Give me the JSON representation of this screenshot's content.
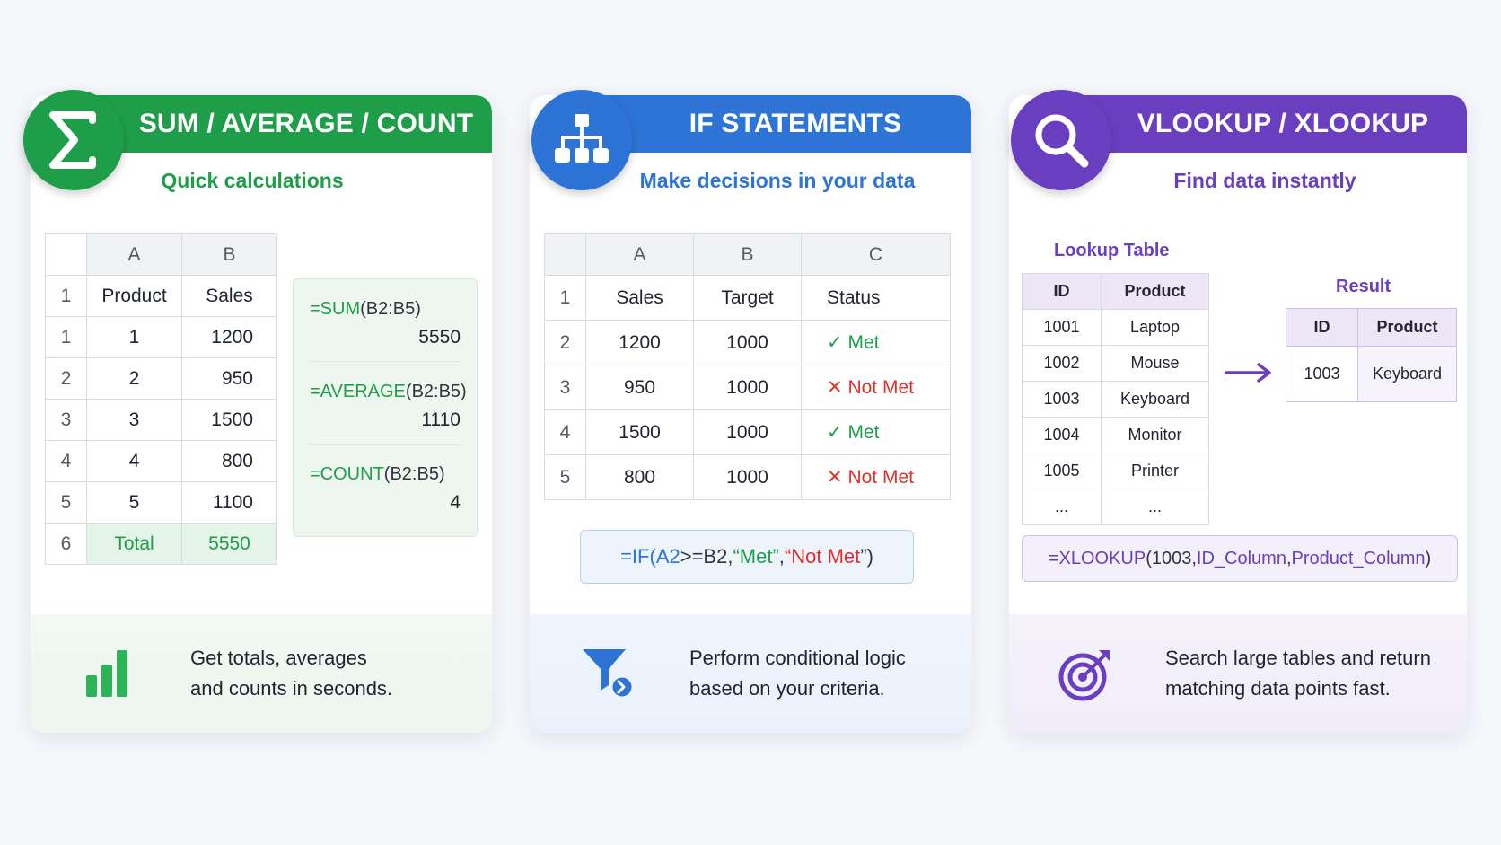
{
  "colors": {
    "green": "#1f9e4a",
    "blue": "#2d74d6",
    "purple": "#6a3fbf",
    "red": "#e0302b"
  },
  "card_sum": {
    "icon": "sigma-icon",
    "title": "SUM / AVERAGE / COUNT",
    "subtitle": "Quick calculations",
    "table": {
      "col_headers": [
        "A",
        "B"
      ],
      "header_row": {
        "num": "1",
        "a": "Product",
        "b": "Sales"
      },
      "rows": [
        {
          "num": "1",
          "a": "1",
          "b": "1200"
        },
        {
          "num": "2",
          "a": "2",
          "b": "950"
        },
        {
          "num": "3",
          "a": "3",
          "b": "1500"
        },
        {
          "num": "4",
          "a": "4",
          "b": "800"
        },
        {
          "num": "5",
          "a": "5",
          "b": "1100"
        }
      ],
      "total_row": {
        "num": "6",
        "a": "Total",
        "b": "5550"
      }
    },
    "formulas": [
      {
        "fn": "=SUM",
        "args": "(B2:B5)",
        "result": "5550"
      },
      {
        "fn": "=AVERAGE",
        "args": "(B2:B5)",
        "result": "1110"
      },
      {
        "fn": "=COUNT",
        "args": "(B2:B5)",
        "result": "4"
      }
    ],
    "desc_icon": "bar-chart-icon",
    "desc_line1": "Get totals, averages",
    "desc_line2": "and counts in seconds."
  },
  "card_if": {
    "icon": "hierarchy-icon",
    "title": "IF STATEMENTS",
    "subtitle": "Make decisions in your data",
    "table": {
      "col_headers": [
        "A",
        "B",
        "C"
      ],
      "header_row": {
        "num": "1",
        "a": "Sales",
        "b": "Target",
        "c": "Status"
      },
      "rows": [
        {
          "num": "2",
          "a": "1200",
          "b": "1000",
          "mark": "✓",
          "c": "Met"
        },
        {
          "num": "3",
          "a": "950",
          "b": "1000",
          "mark": "✕",
          "c": "Not Met"
        },
        {
          "num": "4",
          "a": "1500",
          "b": "1000",
          "mark": "✓",
          "c": "Met"
        },
        {
          "num": "5",
          "a": "800",
          "b": "1000",
          "mark": "✕",
          "c": "Not Met"
        }
      ]
    },
    "formula": {
      "p1": "=IF(",
      "p2": "A2",
      "p3": ">=B2,",
      "p4": "“Met”",
      "p5": ",",
      "p6": "“Not Met",
      "p7": "”)"
    },
    "desc_icon": "filter-icon",
    "desc_line1": "Perform conditional logic",
    "desc_line2": "based on your criteria."
  },
  "card_lookup": {
    "icon": "magnifier-icon",
    "title": "VLOOKUP / XLOOKUP",
    "subtitle": "Find data instantly",
    "lookup_title": "Lookup Table",
    "lookup_headers": [
      "ID",
      "Product"
    ],
    "lookup_rows": [
      {
        "id": "1001",
        "product": "Laptop"
      },
      {
        "id": "1002",
        "product": "Mouse"
      },
      {
        "id": "1003",
        "product": "Keyboard"
      },
      {
        "id": "1004",
        "product": "Monitor"
      },
      {
        "id": "1005",
        "product": "Printer"
      },
      {
        "id": "...",
        "product": "..."
      }
    ],
    "result_title": "Result",
    "result_headers": [
      "ID",
      "Product"
    ],
    "result_row": {
      "id": "1003",
      "product": "Keyboard"
    },
    "formula": {
      "fn": "=XLOOKUP",
      "a1": "(1003, ",
      "a2": "ID_Column",
      "a3": ", ",
      "a4": "Product_Column",
      "a5": ")"
    },
    "desc_icon": "target-icon",
    "desc_line1": "Search large tables and return",
    "desc_line2": "matching data points fast."
  }
}
